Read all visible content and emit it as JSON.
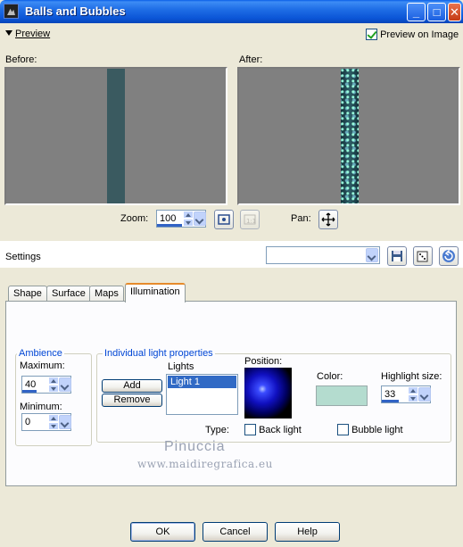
{
  "window": {
    "title": "Balls and Bubbles",
    "minimize": "_",
    "maximize": "□",
    "close": "✕"
  },
  "preview": {
    "toggle_label": "Preview",
    "preview_on_image_label": "Preview on Image",
    "preview_on_image_checked": true,
    "before_label": "Before:",
    "after_label": "After:"
  },
  "zoom": {
    "label": "Zoom:",
    "value": "100",
    "pan_label": "Pan:"
  },
  "settings": {
    "label": "Settings",
    "selected": ""
  },
  "tabs": [
    {
      "label": "Shape",
      "active": false
    },
    {
      "label": "Surface",
      "active": false
    },
    {
      "label": "Maps",
      "active": false
    },
    {
      "label": "Illumination",
      "active": true
    }
  ],
  "illumination": {
    "ambience": {
      "title": "Ambience",
      "maximum_label": "Maximum:",
      "maximum_value": "40",
      "minimum_label": "Minimum:",
      "minimum_value": "0"
    },
    "individual": {
      "title": "Individual light properties",
      "lights_label": "Lights",
      "lights": [
        "Light 1"
      ],
      "add_label": "Add",
      "remove_label": "Remove",
      "position_label": "Position:",
      "color_label": "Color:",
      "color_value": "#b4dccf",
      "highlight_label": "Highlight size:",
      "highlight_value": "33",
      "type_label": "Type:",
      "back_light_label": "Back light",
      "back_light_checked": false,
      "bubble_light_label": "Bubble light",
      "bubble_light_checked": false
    }
  },
  "watermark": {
    "line1": "Pinuccia",
    "line2": "www.maidiregrafica.eu"
  },
  "buttons": {
    "ok": "OK",
    "cancel": "Cancel",
    "help": "Help"
  }
}
